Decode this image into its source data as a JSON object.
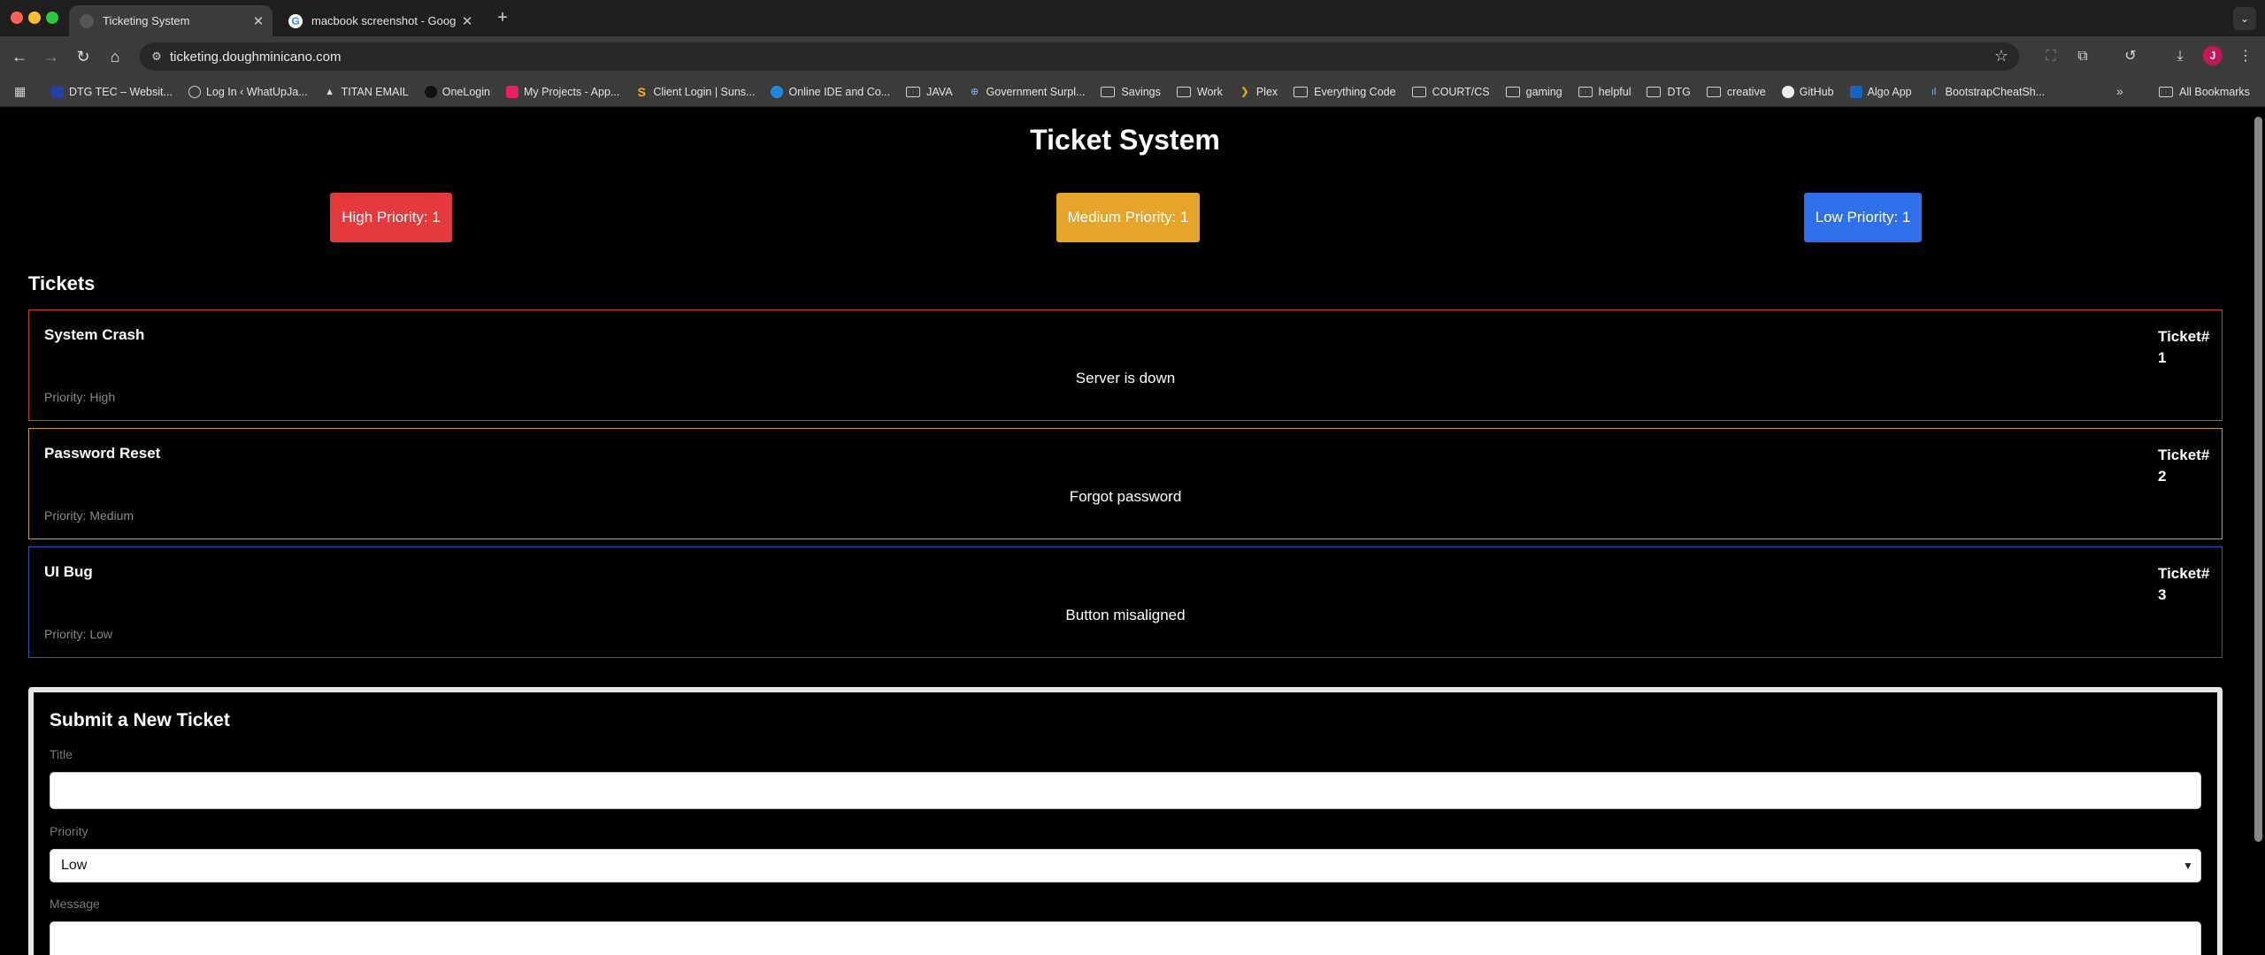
{
  "browser": {
    "tabs": [
      {
        "title": "Ticketing System",
        "active": true
      },
      {
        "title": "macbook screenshot - Googl",
        "active": false
      }
    ],
    "url": "ticketing.doughminicano.com",
    "bookmarks": [
      {
        "label": "DTG TEC – Websit...",
        "icon": "site-icon"
      },
      {
        "label": "Log In ‹ WhatUpJa...",
        "icon": "wordpress-icon"
      },
      {
        "label": "TITAN EMAIL",
        "icon": "site-icon"
      },
      {
        "label": "OneLogin",
        "icon": "site-icon"
      },
      {
        "label": "My Projects - App...",
        "icon": "site-icon"
      },
      {
        "label": "Client Login | Suns...",
        "icon": "site-icon"
      },
      {
        "label": "Online IDE and Co...",
        "icon": "site-icon"
      },
      {
        "label": "JAVA",
        "icon": "folder-icon"
      },
      {
        "label": "Government Surpl...",
        "icon": "site-icon"
      },
      {
        "label": "Savings",
        "icon": "folder-icon"
      },
      {
        "label": "Work",
        "icon": "folder-icon"
      },
      {
        "label": "Plex",
        "icon": "site-icon"
      },
      {
        "label": "Everything Code",
        "icon": "folder-icon"
      },
      {
        "label": "COURT/CS",
        "icon": "folder-icon"
      },
      {
        "label": "gaming",
        "icon": "folder-icon"
      },
      {
        "label": "helpful",
        "icon": "folder-icon"
      },
      {
        "label": "DTG",
        "icon": "folder-icon"
      },
      {
        "label": "creative",
        "icon": "folder-icon"
      },
      {
        "label": "GitHub",
        "icon": "github-icon"
      },
      {
        "label": "Algo App",
        "icon": "site-icon"
      },
      {
        "label": "BootstrapCheatSh...",
        "icon": "site-icon"
      }
    ],
    "all_bookmarks": "All Bookmarks"
  },
  "page": {
    "title": "Ticket System",
    "priority_buttons": {
      "high": "High Priority: 1",
      "medium": "Medium Priority: 1",
      "low": "Low Priority: 1"
    },
    "tickets_heading": "Tickets",
    "tickets": [
      {
        "title": "System Crash",
        "message": "Server is down",
        "priority": "Priority: High",
        "number_label": "Ticket#",
        "number": "1"
      },
      {
        "title": "Password Reset",
        "message": "Forgot password",
        "priority": "Priority: Medium",
        "number_label": "Ticket#",
        "number": "2"
      },
      {
        "title": "UI Bug",
        "message": "Button misaligned",
        "priority": "Priority: Low",
        "number_label": "Ticket#",
        "number": "3"
      }
    ],
    "form": {
      "title": "Submit a New Ticket",
      "title_label": "Title",
      "title_value": "",
      "priority_label": "Priority",
      "priority_value": "Low",
      "message_label": "Message",
      "message_value": ""
    }
  },
  "colors": {
    "high": "#e43a3d",
    "medium": "#e5a52a",
    "low": "#2f6fea",
    "background": "#000000"
  }
}
